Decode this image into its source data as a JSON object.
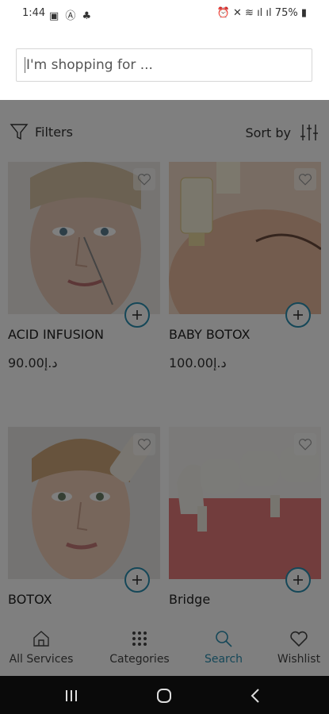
{
  "status_bar": {
    "time": "1:44",
    "battery": "75%"
  },
  "search": {
    "placeholder": "I'm shopping for ..."
  },
  "toolbar": {
    "filters_label": "Filters",
    "sort_label": "Sort by"
  },
  "products": [
    {
      "name": "ACID INFUSION",
      "price": "90.00د.إ"
    },
    {
      "name": "BABY BOTOX",
      "price": "100.00د.إ"
    },
    {
      "name": "BOTOX",
      "price": ""
    },
    {
      "name": "Bridge",
      "price": ""
    }
  ],
  "bottom_nav": [
    {
      "label": "All Services",
      "icon": "home-icon"
    },
    {
      "label": "Categories",
      "icon": "grid-icon"
    },
    {
      "label": "Search",
      "icon": "search-icon"
    },
    {
      "label": "Wishlist",
      "icon": "heart-icon"
    }
  ],
  "colors": {
    "accent": "#2a8fb0",
    "overlay": "rgba(0,0,0,0.5)"
  }
}
